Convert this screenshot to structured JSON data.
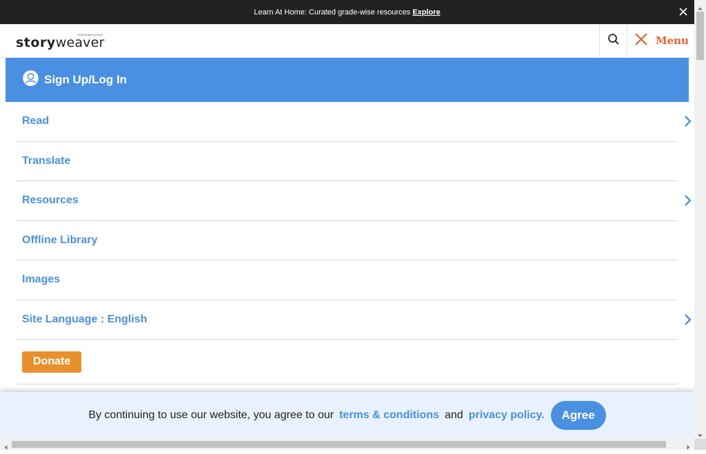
{
  "announcement": {
    "message": "Learn At Home: Curated grade-wise resources",
    "link_label": "Explore"
  },
  "header": {
    "logo_story": "story",
    "logo_weaver": "weaver",
    "logo_tagline": "PRATHAM BOOKS",
    "menu_label": "Menu"
  },
  "signup": {
    "label": "Sign Up/Log In"
  },
  "menu": {
    "items": [
      {
        "label": "Read",
        "has_submenu": true
      },
      {
        "label": "Translate",
        "has_submenu": false
      },
      {
        "label": "Resources",
        "has_submenu": true
      },
      {
        "label": "Offline Library",
        "has_submenu": false
      },
      {
        "label": "Images",
        "has_submenu": false
      },
      {
        "label": "Site Language : English",
        "has_submenu": true
      }
    ],
    "donate_label": "Donate"
  },
  "consent": {
    "prefix": "By continuing to use our website, you agree to our",
    "terms_label": "terms & conditions",
    "and_text": "and",
    "privacy_label": "privacy policy.",
    "agree_label": "Agree"
  },
  "colors": {
    "accent_blue": "#4a90e2",
    "brand_orange": "#e8612c",
    "donate_orange": "#e8912c",
    "announce_bg": "#222222"
  },
  "icons": {
    "close": "close-icon",
    "search": "search-icon",
    "menu_close": "close-x-icon",
    "user": "user-icon",
    "chevron": "chevron-right-icon"
  }
}
